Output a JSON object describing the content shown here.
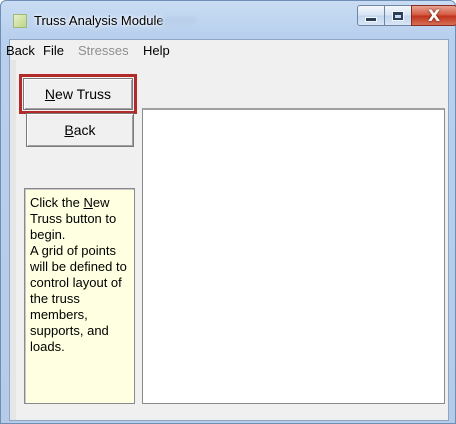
{
  "window": {
    "title": "Truss Analysis Module",
    "close_glyph": "X"
  },
  "menu": {
    "items": [
      {
        "label": "Back",
        "enabled": true
      },
      {
        "label": "File",
        "enabled": true
      },
      {
        "label": "Stresses",
        "enabled": false
      },
      {
        "label": "Help",
        "enabled": true
      }
    ]
  },
  "buttons": {
    "new_truss": {
      "accel": "N",
      "rest": "ew Truss"
    },
    "back": {
      "accel": "B",
      "rest": "ack"
    }
  },
  "hint": {
    "line1_prefix": "Click the ",
    "line1_accel": "N",
    "line1_suffix": "ew Truss button to begin.",
    "body": "A grid of points will be defined to control layout of the truss members, supports, and loads."
  },
  "colors": {
    "highlight_border": "#b22a2a",
    "hint_background": "#ffffe1",
    "disabled_menu": "#8f8f8f"
  },
  "icons": {
    "app": "app-icon",
    "minimize": "minimize-icon",
    "maximize": "maximize-icon",
    "close": "close-icon"
  }
}
